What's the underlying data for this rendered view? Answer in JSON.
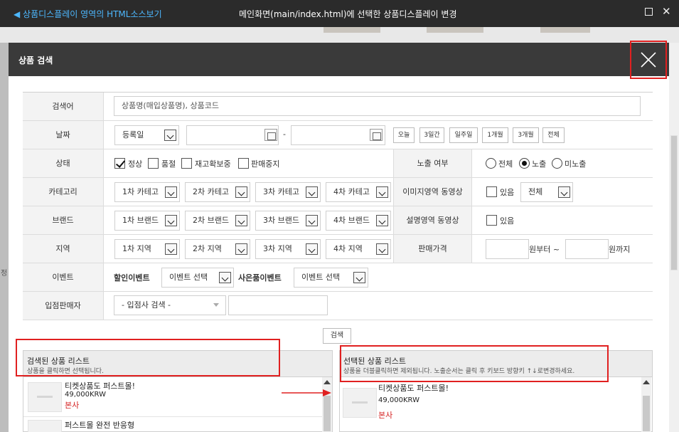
{
  "window": {
    "left_link": "◀ 상품디스플레이 영역의 HTML소스보기",
    "title": "메인화면(main/index.html)에 선택한 상품디스플레이 변경",
    "close_glyph": "✕"
  },
  "modal": {
    "title": "상품 검색"
  },
  "form": {
    "keyword": {
      "label": "검색어",
      "placeholder": "상품명(매입상품명), 상품코드"
    },
    "date": {
      "label": "날짜",
      "type_value": "등록일",
      "separator": "-",
      "quick_buttons": [
        "오늘",
        "3일간",
        "일주일",
        "1개월",
        "3개월",
        "전체"
      ]
    },
    "status": {
      "label": "상태",
      "options": [
        {
          "label": "정상",
          "checked": true
        },
        {
          "label": "품절",
          "checked": false
        },
        {
          "label": "재고확보중",
          "checked": false
        },
        {
          "label": "판매중지",
          "checked": false
        }
      ],
      "exposure_label": "노출 여부",
      "exposure_options": [
        {
          "label": "전체",
          "selected": false
        },
        {
          "label": "노출",
          "selected": true
        },
        {
          "label": "미노출",
          "selected": false
        }
      ]
    },
    "category": {
      "label": "카테고리",
      "selects": [
        "1차 카테고",
        "2차 카테고",
        "3차 카테고",
        "4차 카테고"
      ],
      "image_video_label": "이미지영역 동영상",
      "image_video_check": "있음",
      "image_video_select": "전체"
    },
    "brand": {
      "label": "브랜드",
      "selects": [
        "1차 브랜드",
        "2차 브랜드",
        "3차 브랜드",
        "4차 브랜드"
      ],
      "desc_video_label": "설명영역 동영상",
      "desc_video_check": "있음"
    },
    "region": {
      "label": "지역",
      "selects": [
        "1차 지역",
        "2차 지역",
        "3차 지역",
        "4차 지역"
      ],
      "price_label": "판매가격",
      "price_from_suffix": "원부터 ~",
      "price_to_suffix": "원까지"
    },
    "event": {
      "label": "이벤트",
      "discount_label": "할인이벤트",
      "discount_select": "이벤트 선택",
      "gift_label": "사은품이벤트",
      "gift_select": "이벤트 선택"
    },
    "seller": {
      "label": "입점판매자",
      "select": "- 입점사 검색 -"
    }
  },
  "search_button": "검색",
  "left_list": {
    "title": "검색된 상품 리스트",
    "hint": "상품을 클릭하면 선택됩니다.",
    "items": [
      {
        "name": "티켓상품도 퍼스트몰!",
        "price": "49,000KRW",
        "shop": "본사"
      },
      {
        "name": "퍼스트몰 완전 반응형",
        "price": "",
        "shop": ""
      }
    ]
  },
  "right_list": {
    "title": "선택된 상품 리스트",
    "hint": "상품을 더블클릭하면 제외됩니다. 노출순서는 클릭 후 키보드 방향키 ↑↓로변경하세요.",
    "items": [
      {
        "name": "티켓상품도 퍼스트몰!",
        "price": "49,000KRW",
        "shop": "본사"
      }
    ]
  },
  "side_glyphs": {
    "left_a": "정",
    "left_b": "∞"
  },
  "colors": {
    "accent_red": "#e02020",
    "link_blue": "#4db8ff",
    "header_dark": "#3a3a3a"
  }
}
